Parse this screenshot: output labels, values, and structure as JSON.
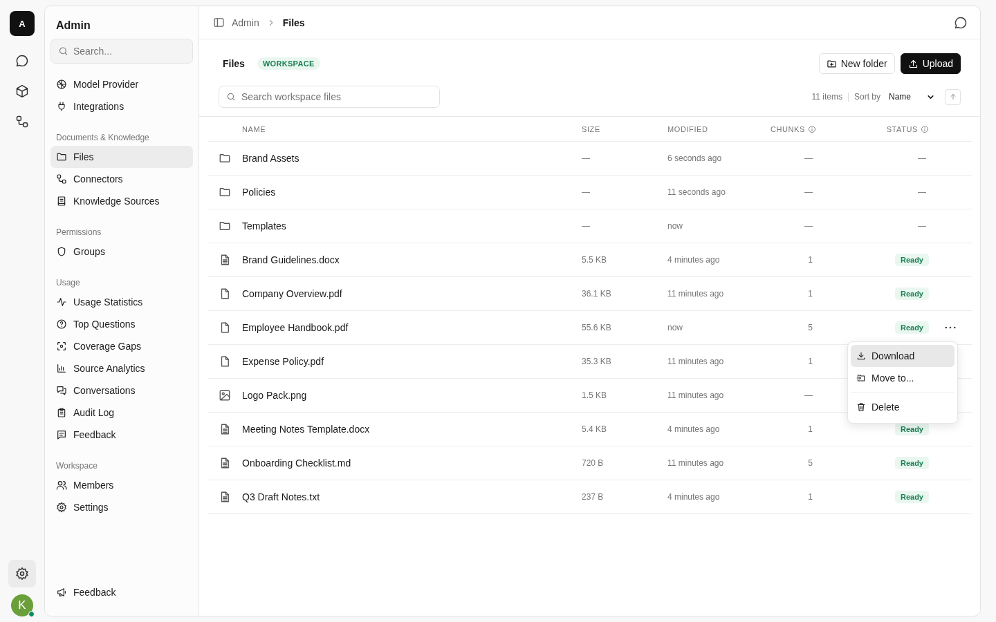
{
  "rail": {
    "logo": "A",
    "settings_selected": true,
    "user": {
      "initial": "K",
      "online": true
    }
  },
  "sidebar": {
    "title": "Admin",
    "search_placeholder": "Search...",
    "sections": [
      {
        "items": [
          {
            "label": "Model Provider",
            "selected": false
          },
          {
            "label": "Integrations",
            "selected": false
          }
        ]
      },
      {
        "heading": "Documents & Knowledge",
        "items": [
          {
            "label": "Files",
            "selected": true
          },
          {
            "label": "Connectors",
            "selected": false
          },
          {
            "label": "Knowledge Sources",
            "selected": false
          }
        ]
      },
      {
        "heading": "Permissions",
        "items": [
          {
            "label": "Groups",
            "selected": false
          }
        ]
      },
      {
        "heading": "Usage",
        "items": [
          {
            "label": "Usage Statistics",
            "selected": false
          },
          {
            "label": "Top Questions",
            "selected": false
          },
          {
            "label": "Coverage Gaps",
            "selected": false
          },
          {
            "label": "Source Analytics",
            "selected": false
          },
          {
            "label": "Conversations",
            "selected": false
          },
          {
            "label": "Audit Log",
            "selected": false
          },
          {
            "label": "Feedback",
            "selected": false
          }
        ]
      },
      {
        "heading": "Workspace",
        "items": [
          {
            "label": "Members",
            "selected": false
          },
          {
            "label": "Settings",
            "selected": false
          }
        ]
      }
    ],
    "footer_item": "Feedback"
  },
  "breadcrumbs": [
    {
      "label": "Admin",
      "current": false
    },
    {
      "label": "Files",
      "current": true
    }
  ],
  "header": {
    "title": "Files",
    "badge": "WORKSPACE",
    "new_folder": "New folder",
    "upload": "Upload",
    "search_placeholder": "Search workspace files",
    "item_count": "11 items",
    "sort_label": "Sort by",
    "sort_value": "Name"
  },
  "columns": [
    {
      "label": "NAME",
      "info": false
    },
    {
      "label": "SIZE",
      "info": false
    },
    {
      "label": "MODIFIED",
      "info": false
    },
    {
      "label": "CHUNKS",
      "info": true
    },
    {
      "label": "STATUS",
      "info": true
    }
  ],
  "rows": [
    {
      "kind": "folder",
      "name": "Brand Assets",
      "size": "—",
      "modified": "6 seconds ago",
      "chunks": "—",
      "status": "—",
      "menu_open": false
    },
    {
      "kind": "folder",
      "name": "Policies",
      "size": "—",
      "modified": "11 seconds ago",
      "chunks": "—",
      "status": "—",
      "menu_open": false
    },
    {
      "kind": "folder",
      "name": "Templates",
      "size": "—",
      "modified": "now",
      "chunks": "—",
      "status": "—",
      "menu_open": false
    },
    {
      "kind": "doc",
      "name": "Brand Guidelines.docx",
      "size": "5.5 KB",
      "modified": "4 minutes ago",
      "chunks": "1",
      "status": "Ready",
      "menu_open": false
    },
    {
      "kind": "file",
      "name": "Company Overview.pdf",
      "size": "36.1 KB",
      "modified": "11 minutes ago",
      "chunks": "1",
      "status": "Ready",
      "menu_open": false
    },
    {
      "kind": "file",
      "name": "Employee Handbook.pdf",
      "size": "55.6 KB",
      "modified": "now",
      "chunks": "5",
      "status": "Ready",
      "menu_open": true
    },
    {
      "kind": "file",
      "name": "Expense Policy.pdf",
      "size": "35.3 KB",
      "modified": "11 minutes ago",
      "chunks": "1",
      "menu_open": false
    },
    {
      "kind": "image",
      "name": "Logo Pack.png",
      "size": "1.5 KB",
      "modified": "11 minutes ago",
      "chunks": "—",
      "menu_open": false
    },
    {
      "kind": "doc",
      "name": "Meeting Notes Template.docx",
      "size": "5.4 KB",
      "modified": "4 minutes ago",
      "chunks": "1",
      "status": "Ready",
      "menu_open": false
    },
    {
      "kind": "doc",
      "name": "Onboarding Checklist.md",
      "size": "720 B",
      "modified": "11 minutes ago",
      "chunks": "5",
      "status": "Ready",
      "menu_open": false
    },
    {
      "kind": "doc",
      "name": "Q3 Draft Notes.txt",
      "size": "237 B",
      "modified": "4 minutes ago",
      "chunks": "1",
      "status": "Ready",
      "menu_open": false
    }
  ],
  "menu": [
    {
      "kind": "download",
      "label": "Download",
      "selected": true,
      "separated": false
    },
    {
      "kind": "move",
      "label": "Move to...",
      "selected": false,
      "separated": false
    },
    {
      "kind": "delete",
      "label": "Delete",
      "selected": false,
      "separated": true
    }
  ]
}
